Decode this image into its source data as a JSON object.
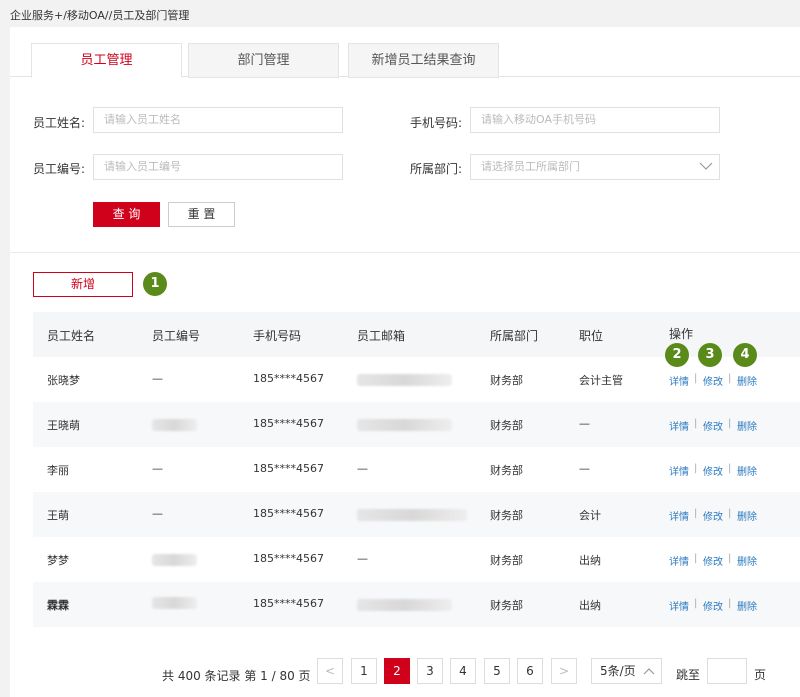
{
  "breadcrumb": "企业服务+/移动OA//员工及部门管理",
  "tabs": [
    {
      "label": "员工管理",
      "active": true
    },
    {
      "label": "部门管理",
      "active": false
    },
    {
      "label": "新增员工结果查询",
      "active": false
    }
  ],
  "form": {
    "name_label": "员工姓名:",
    "name_placeholder": "请输入员工姓名",
    "phone_label": "手机号码:",
    "phone_placeholder": "请输入移动OA手机号码",
    "id_label": "员工编号:",
    "id_placeholder": "请输入员工编号",
    "dept_label": "所属部门:",
    "dept_placeholder": "请选择员工所属部门",
    "query_label": "查 询",
    "reset_label": "重 置"
  },
  "add_label": "新增",
  "badges": [
    "1",
    "2",
    "3",
    "4"
  ],
  "table": {
    "headers": [
      "员工姓名",
      "员工编号",
      "手机号码",
      "员工邮箱",
      "所属部门",
      "职位",
      "操作"
    ],
    "rows": [
      {
        "name": "张晓梦",
        "id": "—",
        "phone": "185****4567",
        "email": "",
        "dept": "财务部",
        "position": "会计主管"
      },
      {
        "name": "王晓萌",
        "id": "",
        "phone": "185****4567",
        "email": "",
        "dept": "财务部",
        "position": "—"
      },
      {
        "name": "李丽",
        "id": "—",
        "phone": "185****4567",
        "email": "—",
        "dept": "财务部",
        "position": "—"
      },
      {
        "name": "王萌",
        "id": "—",
        "phone": "185****4567",
        "email": "",
        "dept": "财务部",
        "position": "会计"
      },
      {
        "name": "梦梦",
        "id": "",
        "phone": "185****4567",
        "email": "—",
        "dept": "财务部",
        "position": "出纳"
      },
      {
        "name": "霖霖",
        "id": "",
        "phone": "185****4567",
        "email": "",
        "dept": "财务部",
        "position": "出纳"
      }
    ],
    "actions": {
      "detail": "详情",
      "edit": "修改",
      "delete": "删除",
      "sep": "|"
    }
  },
  "pagination": {
    "summary": "共 400 条记录 第 1 / 80 页",
    "prev": "<",
    "next": ">",
    "pages": [
      "1",
      "2",
      "3",
      "4",
      "5",
      "6"
    ],
    "current": "2",
    "page_size": "5条/页",
    "jump_label": "跳至",
    "jump_unit": "页"
  },
  "colors": {
    "accent": "#d0021b",
    "badge": "#5a8a1a",
    "link": "#2a7ac0"
  }
}
